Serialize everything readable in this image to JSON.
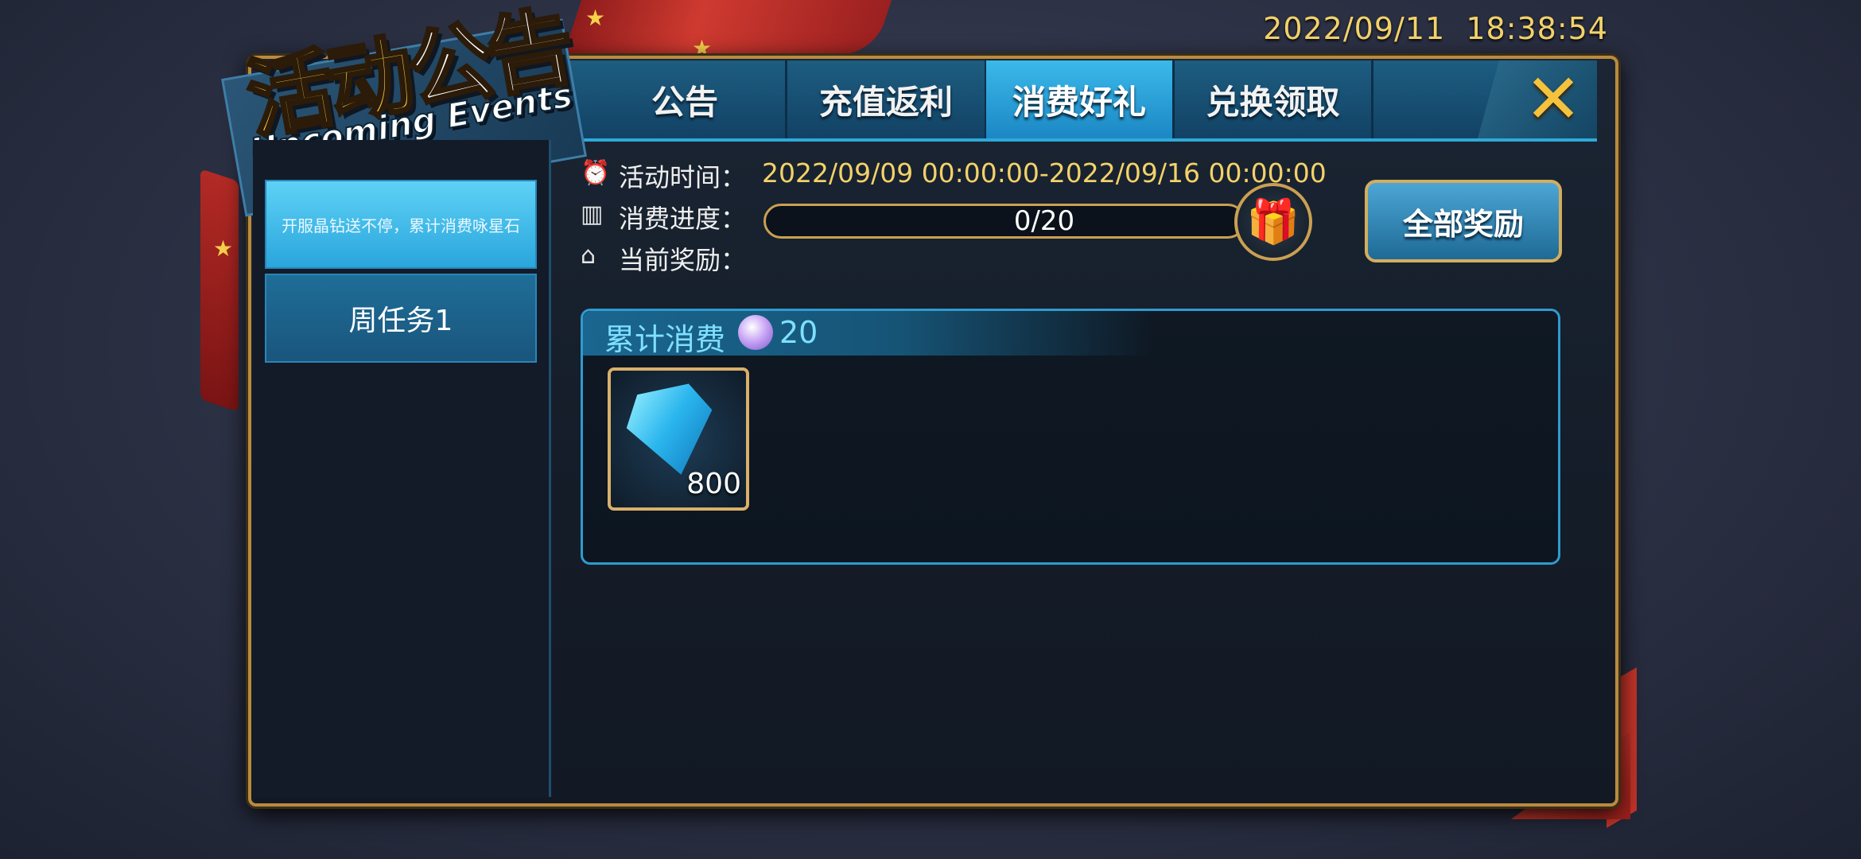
{
  "status": {
    "timestamp": "2022/09/11  18:38:54"
  },
  "title": {
    "cn_part1": "活动",
    "cn_part2": "公告",
    "en": "Upcoming Events"
  },
  "tabs": [
    {
      "label": "公告"
    },
    {
      "label": "充值返利"
    },
    {
      "label": "消费好礼",
      "active": true
    },
    {
      "label": "兑换领取"
    }
  ],
  "close": {
    "label": "✕"
  },
  "sidebar": {
    "items": [
      {
        "label": "开服晶钻送不停，累计消费咏星石",
        "selected": true
      },
      {
        "label": "周任务1"
      }
    ]
  },
  "info": {
    "time_label": "活动时间：",
    "time_value": "2022/09/09 00:00:00-2022/09/16 00:00:00",
    "progress_label": "消费进度：",
    "progress_text": "0/20",
    "progress_fraction": 0,
    "reward_label": "当前奖励："
  },
  "buttons": {
    "all_rewards": "全部奖励"
  },
  "reward_card": {
    "title": "累计消费",
    "amount": "20",
    "items": [
      {
        "icon": "diamond-icon",
        "count": "800"
      }
    ]
  },
  "icons": {
    "time": "alarm-clock-icon",
    "progress": "bar-chart-icon",
    "reward": "gift-icon"
  },
  "colors": {
    "accent_gold": "#f3d26a",
    "tab_active": "#3bb9ea",
    "card_text": "#7fe0ff"
  }
}
